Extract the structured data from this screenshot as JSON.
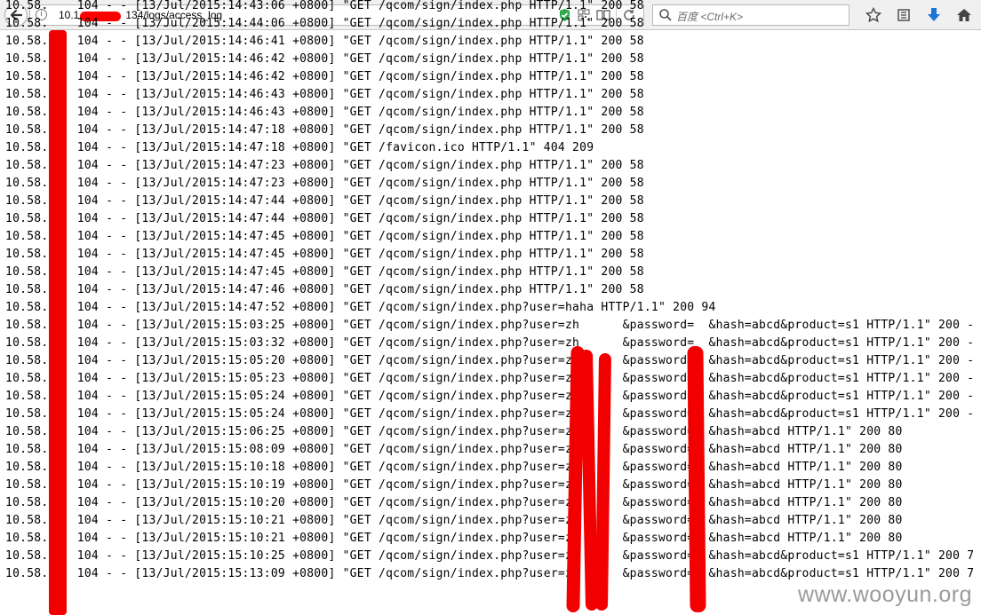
{
  "browser": {
    "url_prefix": "10.1",
    "url_suffix": "134/logs/access_log",
    "search_placeholder": "百度 <Ctrl+K>"
  },
  "log_lines": [
    "10.58.    104 - - [13/Jul/2015:14:43:06 +0800] \"GET /qcom/sign/index.php HTTP/1.1\" 200 58",
    "10.58.    104 - - [13/Jul/2015:14:44:06 +0800] \"GET /qcom/sign/index.php HTTP/1.1\" 200 58",
    "10.58.    104 - - [13/Jul/2015:14:46:41 +0800] \"GET /qcom/sign/index.php HTTP/1.1\" 200 58",
    "10.58.    104 - - [13/Jul/2015:14:46:42 +0800] \"GET /qcom/sign/index.php HTTP/1.1\" 200 58",
    "10.58.    104 - - [13/Jul/2015:14:46:42 +0800] \"GET /qcom/sign/index.php HTTP/1.1\" 200 58",
    "10.58.    104 - - [13/Jul/2015:14:46:43 +0800] \"GET /qcom/sign/index.php HTTP/1.1\" 200 58",
    "10.58.    104 - - [13/Jul/2015:14:46:43 +0800] \"GET /qcom/sign/index.php HTTP/1.1\" 200 58",
    "10.58.    104 - - [13/Jul/2015:14:47:18 +0800] \"GET /qcom/sign/index.php HTTP/1.1\" 200 58",
    "10.58.    104 - - [13/Jul/2015:14:47:18 +0800] \"GET /favicon.ico HTTP/1.1\" 404 209",
    "10.58.    104 - - [13/Jul/2015:14:47:23 +0800] \"GET /qcom/sign/index.php HTTP/1.1\" 200 58",
    "10.58.    104 - - [13/Jul/2015:14:47:23 +0800] \"GET /qcom/sign/index.php HTTP/1.1\" 200 58",
    "10.58.    104 - - [13/Jul/2015:14:47:44 +0800] \"GET /qcom/sign/index.php HTTP/1.1\" 200 58",
    "10.58.    104 - - [13/Jul/2015:14:47:44 +0800] \"GET /qcom/sign/index.php HTTP/1.1\" 200 58",
    "10.58.    104 - - [13/Jul/2015:14:47:45 +0800] \"GET /qcom/sign/index.php HTTP/1.1\" 200 58",
    "10.58.    104 - - [13/Jul/2015:14:47:45 +0800] \"GET /qcom/sign/index.php HTTP/1.1\" 200 58",
    "10.58.    104 - - [13/Jul/2015:14:47:45 +0800] \"GET /qcom/sign/index.php HTTP/1.1\" 200 58",
    "10.58.    104 - - [13/Jul/2015:14:47:46 +0800] \"GET /qcom/sign/index.php HTTP/1.1\" 200 58",
    "10.58.    104 - - [13/Jul/2015:14:47:52 +0800] \"GET /qcom/sign/index.php?user=haha HTTP/1.1\" 200 94",
    "10.58.    104 - - [13/Jul/2015:15:03:25 +0800] \"GET /qcom/sign/index.php?user=zh      &password=  &hash=abcd&product=s1 HTTP/1.1\" 200 -",
    "10.58.    104 - - [13/Jul/2015:15:03:32 +0800] \"GET /qcom/sign/index.php?user=zh      &password=  &hash=abcd&product=s1 HTTP/1.1\" 200 -",
    "10.58.    104 - - [13/Jul/2015:15:05:20 +0800] \"GET /qcom/sign/index.php?user=zh      &password=  &hash=abcd&product=s1 HTTP/1.1\" 200 -",
    "10.58.    104 - - [13/Jul/2015:15:05:23 +0800] \"GET /qcom/sign/index.php?user=zh      &password=  &hash=abcd&product=s1 HTTP/1.1\" 200 -",
    "10.58.    104 - - [13/Jul/2015:15:05:24 +0800] \"GET /qcom/sign/index.php?user=zh      &password=  &hash=abcd&product=s1 HTTP/1.1\" 200 -",
    "10.58.    104 - - [13/Jul/2015:15:05:24 +0800] \"GET /qcom/sign/index.php?user=zh      &password=  &hash=abcd&product=s1 HTTP/1.1\" 200 -",
    "10.58.    104 - - [13/Jul/2015:15:06:25 +0800] \"GET /qcom/sign/index.php?user=zh      &password=  &hash=abcd HTTP/1.1\" 200 80",
    "10.58.    104 - - [13/Jul/2015:15:08:09 +0800] \"GET /qcom/sign/index.php?user=zh      &password=  &hash=abcd HTTP/1.1\" 200 80",
    "10.58.    104 - - [13/Jul/2015:15:10:18 +0800] \"GET /qcom/sign/index.php?user=zh      &password=  &hash=abcd HTTP/1.1\" 200 80",
    "10.58.    104 - - [13/Jul/2015:15:10:19 +0800] \"GET /qcom/sign/index.php?user=zh      &password=  &hash=abcd HTTP/1.1\" 200 80",
    "10.58.    104 - - [13/Jul/2015:15:10:20 +0800] \"GET /qcom/sign/index.php?user=zh      &password=  &hash=abcd HTTP/1.1\" 200 80",
    "10.58.    104 - - [13/Jul/2015:15:10:21 +0800] \"GET /qcom/sign/index.php?user=zh      &password=  &hash=abcd HTTP/1.1\" 200 80",
    "10.58.    104 - - [13/Jul/2015:15:10:21 +0800] \"GET /qcom/sign/index.php?user=zh      &password=  &hash=abcd HTTP/1.1\" 200 80",
    "10.58.    104 - - [13/Jul/2015:15:10:25 +0800] \"GET /qcom/sign/index.php?user=zh      &password=  &hash=abcd&product=s1 HTTP/1.1\" 200 7",
    "10.58.    104 - - [13/Jul/2015:15:13:09 +0800] \"GET /qcom/sign/index.php?user=zh      &password=  &hash=abcd&product=s1 HTTP/1.1\" 200 7"
  ],
  "watermark": "www.wooyun.org",
  "colors": {
    "redaction": "#f20000",
    "toolbar": "#f0f0f0",
    "page": "#ffffff"
  },
  "icons": [
    "back-arrow-icon",
    "info-icon",
    "shield-check-icon",
    "qr-code-icon",
    "reader-view-icon",
    "reload-icon",
    "search-icon",
    "star-icon",
    "bookmarks-list-icon",
    "download-icon",
    "home-icon"
  ]
}
